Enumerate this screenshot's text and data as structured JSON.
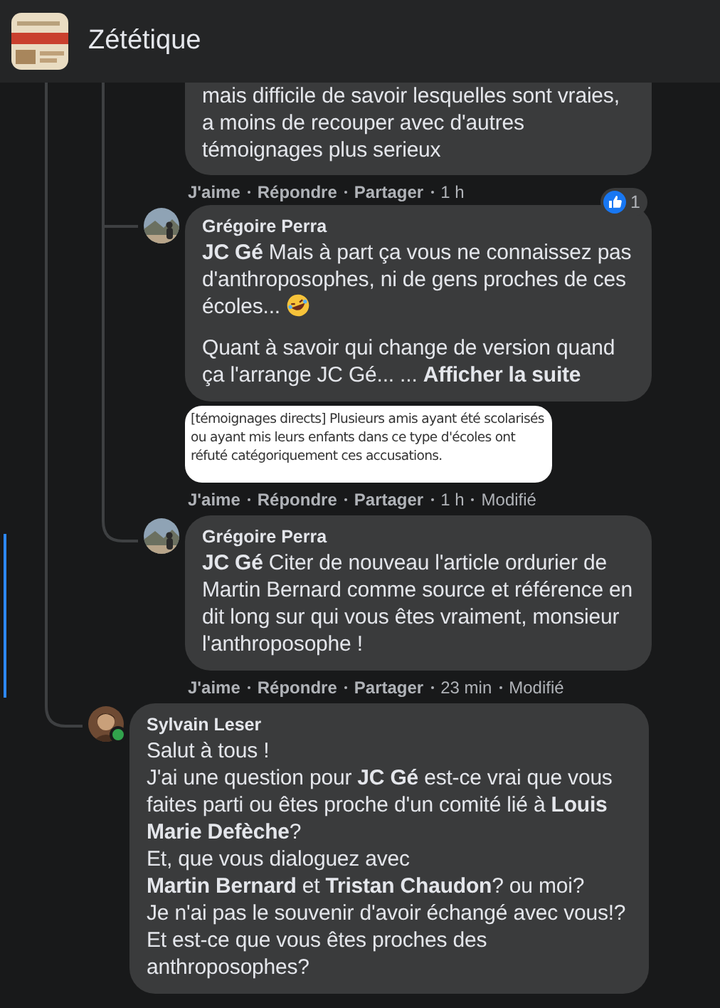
{
  "header": {
    "group_name": "Zététique"
  },
  "nested_replies": [
    {
      "paragraphs": [
        "mais difficile de savoir lesquelles sont vraies, a moins de recouper avec d'autres témoignages plus serieux"
      ],
      "cut_top": true,
      "actions": [
        "J'aime",
        "Répondre",
        "Partager"
      ],
      "time": "1 h"
    },
    {
      "author": "Grégoire Perra",
      "paragraphs": [
        "**JC Gé** Mais à part ça vous ne connaissez pas d'anthroposophes, ni de gens proches de ces écoles...",
        "Quant à savoir qui change de version quand ça l'arrange JC Gé... ..."
      ],
      "laugh_emoji": true,
      "see_more": "Afficher la suite",
      "attachment": {
        "text": "[témoignages directs] Plusieurs amis ayant été scolarisés ou ayant mis leurs enfants dans ce type d'écoles ont réfuté catégoriquement ces accusations."
      },
      "actions": [
        "J'aime",
        "Répondre",
        "Partager"
      ],
      "time": "1 h",
      "edited": "Modifié",
      "reactions": {
        "count": "1"
      }
    },
    {
      "author": "Grégoire Perra",
      "paragraphs": [
        "**JC Gé** Citer de nouveau l'article ordurier de Martin Bernard comme source et référence en dit long sur qui vous êtes vraiment, monsieur l'anthroposophe !"
      ],
      "actions": [
        "J'aime",
        "Répondre",
        "Partager"
      ],
      "time": "23 min",
      "edited": "Modifié"
    }
  ],
  "replies": [
    {
      "author": "Sylvain Leser",
      "online": true,
      "lines": [
        "Salut à tous !",
        "J'ai une question pour **JC Gé** est-ce vrai que vous faites parti ou êtes proche d'un comité lié à **Louis Marie Defèche**?",
        "Et, que vous dialoguez avec",
        "**Martin Bernard** et **Tristan Chaudon**? ou moi?",
        "Je n'ai pas le souvenir d'avoir échangé avec vous!?",
        "Et est-ce que vous êtes proches des anthroposophes?"
      ]
    }
  ]
}
